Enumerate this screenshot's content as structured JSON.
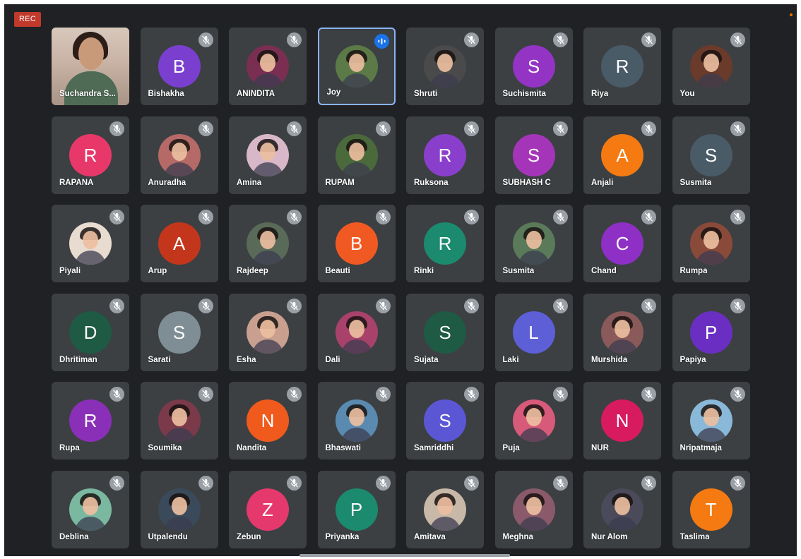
{
  "recording_badge": "REC",
  "colors": {
    "background": "#202124",
    "tile": "#3c4043",
    "speaking_border": "#8ab4f8",
    "mic_off": "#9aa0a6",
    "speaking_indicator": "#1a73e8",
    "rec_badge": "#c0392b"
  },
  "participants": [
    {
      "name": "Suchandra S...",
      "avatar": "self-video",
      "mic": "on",
      "video": "on"
    },
    {
      "name": "Bishakha",
      "avatar": "letter",
      "letter": "B",
      "color": "#7b3fd0",
      "mic": "off"
    },
    {
      "name": "ANINDITA",
      "avatar": "photo",
      "color": "#7a2f52",
      "mic": "off"
    },
    {
      "name": "Joy",
      "avatar": "photo",
      "color": "#5c7a48",
      "mic": "speaking",
      "speaking": true
    },
    {
      "name": "Shruti",
      "avatar": "photo",
      "color": "#4a4a4a",
      "mic": "off"
    },
    {
      "name": "Suchismita",
      "avatar": "letter",
      "letter": "S",
      "color": "#9334c4",
      "mic": "off"
    },
    {
      "name": "Riya",
      "avatar": "letter",
      "letter": "R",
      "color": "#4a5b68",
      "mic": "off"
    },
    {
      "name": "You",
      "avatar": "photo",
      "color": "#6a3a2a",
      "mic": "off"
    },
    {
      "name": "RAPANA",
      "avatar": "letter",
      "letter": "R",
      "color": "#e8386a",
      "mic": "off"
    },
    {
      "name": "Anuradha",
      "avatar": "photo",
      "color": "#b56a68",
      "mic": "off"
    },
    {
      "name": "Amina",
      "avatar": "photo",
      "color": "#d8b8c8",
      "mic": "off"
    },
    {
      "name": "RUPAM",
      "avatar": "photo",
      "color": "#4a6a3c",
      "mic": "off"
    },
    {
      "name": "Ruksona",
      "avatar": "letter",
      "letter": "R",
      "color": "#8a3fcc",
      "mic": "off"
    },
    {
      "name": "SUBHASH C",
      "avatar": "letter",
      "letter": "S",
      "color": "#a535b8",
      "mic": "off"
    },
    {
      "name": "Anjali",
      "avatar": "letter",
      "letter": "A",
      "color": "#f57a12",
      "mic": "off"
    },
    {
      "name": "Susmita",
      "avatar": "letter",
      "letter": "S",
      "color": "#4a5b68",
      "mic": "off"
    },
    {
      "name": "Piyali",
      "avatar": "photo",
      "color": "#e8dcd0",
      "mic": "off"
    },
    {
      "name": "Arup",
      "avatar": "letter",
      "letter": "A",
      "color": "#c4361c",
      "mic": "off"
    },
    {
      "name": "Rajdeep",
      "avatar": "photo",
      "color": "#5a6a58",
      "mic": "off"
    },
    {
      "name": "Beauti",
      "avatar": "letter",
      "letter": "B",
      "color": "#f05a22",
      "mic": "off"
    },
    {
      "name": "Rinki",
      "avatar": "letter",
      "letter": "R",
      "color": "#1b8a6e",
      "mic": "off"
    },
    {
      "name": "Susmita",
      "avatar": "photo",
      "color": "#5a7a5a",
      "mic": "off"
    },
    {
      "name": "Chand",
      "avatar": "letter",
      "letter": "C",
      "color": "#8e2fc6",
      "mic": "off"
    },
    {
      "name": "Rumpa",
      "avatar": "photo",
      "color": "#8a4a3a",
      "mic": "off"
    },
    {
      "name": "Dhritiman",
      "avatar": "letter",
      "letter": "D",
      "color": "#1e5a44",
      "mic": "off"
    },
    {
      "name": "Sarati",
      "avatar": "letter",
      "letter": "S",
      "color": "#7e8e94",
      "mic": "off"
    },
    {
      "name": "Esha",
      "avatar": "photo",
      "color": "#c9a090",
      "mic": "off"
    },
    {
      "name": "Dali",
      "avatar": "photo",
      "color": "#a8426a",
      "mic": "off"
    },
    {
      "name": "Sujata",
      "avatar": "letter",
      "letter": "S",
      "color": "#1e5a44",
      "mic": "off"
    },
    {
      "name": "Laki",
      "avatar": "letter",
      "letter": "L",
      "color": "#5d5fd6",
      "mic": "off"
    },
    {
      "name": "Murshida",
      "avatar": "photo",
      "color": "#8a5a5a",
      "mic": "off"
    },
    {
      "name": "Papiya",
      "avatar": "letter",
      "letter": "P",
      "color": "#6a2fc2",
      "mic": "off"
    },
    {
      "name": "Rupa",
      "avatar": "letter",
      "letter": "R",
      "color": "#8a2fb8",
      "mic": "off"
    },
    {
      "name": "Soumika",
      "avatar": "photo",
      "color": "#7a3a4a",
      "mic": "off"
    },
    {
      "name": "Nandita",
      "avatar": "letter",
      "letter": "N",
      "color": "#f05a1c",
      "mic": "off"
    },
    {
      "name": "Bhaswati",
      "avatar": "photo",
      "color": "#5a8ab0",
      "mic": "off"
    },
    {
      "name": "Samriddhi",
      "avatar": "letter",
      "letter": "S",
      "color": "#5b57d4",
      "mic": "off"
    },
    {
      "name": "Puja",
      "avatar": "photo",
      "color": "#d85a7a",
      "mic": "off"
    },
    {
      "name": "NUR",
      "avatar": "letter",
      "letter": "N",
      "color": "#d81b5e",
      "mic": "off"
    },
    {
      "name": "Nripatmaja",
      "avatar": "photo",
      "color": "#8ab8d8",
      "mic": "off"
    },
    {
      "name": "Deblina",
      "avatar": "photo",
      "color": "#7ab8a0",
      "mic": "off"
    },
    {
      "name": "Utpalendu",
      "avatar": "photo",
      "color": "#3a4a5a",
      "mic": "off"
    },
    {
      "name": "Zebun",
      "avatar": "letter",
      "letter": "Z",
      "color": "#e5396e",
      "mic": "off"
    },
    {
      "name": "Priyanka",
      "avatar": "letter",
      "letter": "P",
      "color": "#1b8a6e",
      "mic": "off"
    },
    {
      "name": "Amitava",
      "avatar": "photo",
      "color": "#c8b8a8",
      "mic": "off"
    },
    {
      "name": "Meghna",
      "avatar": "photo",
      "color": "#8a5a6a",
      "mic": "off"
    },
    {
      "name": "Nur Alom",
      "avatar": "photo",
      "color": "#4a4a5a",
      "mic": "off"
    },
    {
      "name": "Taslima",
      "avatar": "letter",
      "letter": "T",
      "color": "#f57a12",
      "mic": "off"
    }
  ]
}
